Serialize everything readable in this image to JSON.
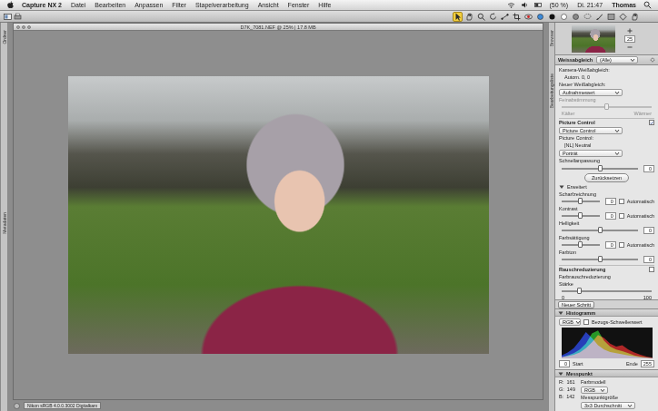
{
  "menubar": {
    "app": "Capture NX 2",
    "items": [
      "Datei",
      "Bearbeiten",
      "Anpassen",
      "Filter",
      "Stapelverarbeitung",
      "Ansicht",
      "Fenster",
      "Hilfe"
    ],
    "battery": "(50 %)",
    "clock": "Di. 21:47",
    "user": "Thomas"
  },
  "toolbar": {
    "tools": [
      {
        "kind": "arrow",
        "selected": true
      },
      {
        "kind": "hand",
        "selected": false
      },
      {
        "kind": "zoom",
        "selected": false
      },
      {
        "kind": "rotate",
        "selected": false
      },
      {
        "kind": "straighten",
        "selected": false
      },
      {
        "kind": "crop",
        "selected": false
      },
      {
        "kind": "redeye",
        "selected": false
      },
      {
        "kind": "point-color",
        "selected": false
      },
      {
        "kind": "point-black",
        "selected": false
      },
      {
        "kind": "point-white",
        "selected": false
      },
      {
        "kind": "point-neutral",
        "selected": false
      },
      {
        "kind": "lasso",
        "selected": false
      },
      {
        "kind": "brush",
        "selected": false
      },
      {
        "kind": "gradient",
        "selected": false
      },
      {
        "kind": "erase",
        "selected": false
      },
      {
        "kind": "hand",
        "selected": false
      }
    ]
  },
  "left_tabs": [
    "Ordner",
    "Metadaten"
  ],
  "right_tabs": [
    "Browser",
    "Bearbeitungsliste"
  ],
  "image_window": {
    "title": "D7K_7081.NEF @ 25% | 17.8 MB"
  },
  "status_bar": {
    "text": "Nikon sRGB 4.0.0.3002 Digitalkam"
  },
  "navigator": {
    "zoom": "25"
  },
  "adjustments": {
    "title": "Weissabgleich",
    "filter": "(Alle)",
    "new_step": "Neuer Schritt",
    "rows": [
      {
        "kind": "label",
        "text": "Kamera-Weißabgleich:"
      },
      {
        "kind": "value",
        "text": "Autom. 0, 0"
      },
      {
        "kind": "label",
        "text": "Neuer Weißabgleich:"
      },
      {
        "kind": "select",
        "text": "Aufnahmewert",
        "disabled": false
      },
      {
        "kind": "range",
        "text": "Feinabstimmung",
        "low": "Kälter",
        "high": "Wärmer",
        "level": 0.5,
        "disabled": true
      },
      {
        "kind": "section",
        "text": "Picture Control",
        "checked": true
      },
      {
        "kind": "select",
        "text": "Picture Control",
        "disabled": false
      },
      {
        "kind": "label",
        "text": "Picture Control:"
      },
      {
        "kind": "value",
        "text": "[NL] Neutral"
      },
      {
        "kind": "select",
        "text": "Porträt",
        "disabled": false
      },
      {
        "kind": "label",
        "text": "Schnellanpassung"
      },
      {
        "kind": "quick",
        "value": "0",
        "level": 0.5
      },
      {
        "kind": "button",
        "text": "Zurücksetzen"
      },
      {
        "kind": "disclosure",
        "text": "Erweitert",
        "expanded": true
      },
      {
        "kind": "adjust",
        "text": "Scharfzeichnung",
        "value": "0",
        "level": 0.5,
        "auto": "Automatisch",
        "auto_checked": false
      },
      {
        "kind": "adjust",
        "text": "Kontrast",
        "value": "0",
        "level": 0.5,
        "auto": "Automatisch",
        "auto_checked": false
      },
      {
        "kind": "adjust",
        "text": "Helligkeit",
        "value": "0",
        "level": 0.5
      },
      {
        "kind": "adjust",
        "text": "Farbsättigung",
        "value": "0",
        "level": 0.5,
        "auto": "Automatisch",
        "auto_checked": false
      },
      {
        "kind": "adjust",
        "text": "Farbton",
        "value": "0",
        "level": 0.5
      },
      {
        "kind": "section",
        "text": "Rauschreduzierung",
        "checked": false
      },
      {
        "kind": "label",
        "text": "Farbrauschreduzierung"
      },
      {
        "kind": "range",
        "text": "Stärke",
        "low": "0",
        "high": "100",
        "level": 0.2,
        "disabled": false
      }
    ]
  },
  "histogram": {
    "title": "Histogramm",
    "channel": "RGB",
    "threshold_label": "Bezugs-Schwellenwert",
    "threshold_checked": false,
    "series": [
      {
        "name": "R",
        "color": "#e02020",
        "values": [
          5,
          8,
          12,
          20,
          35,
          55,
          80,
          70,
          50,
          40,
          45,
          30,
          20,
          12,
          6,
          2
        ]
      },
      {
        "name": "G",
        "color": "#20c020",
        "values": [
          4,
          10,
          18,
          30,
          50,
          85,
          95,
          60,
          40,
          30,
          25,
          18,
          10,
          6,
          3,
          1
        ]
      },
      {
        "name": "B",
        "color": "#2040f0",
        "values": [
          10,
          20,
          35,
          60,
          90,
          70,
          45,
          30,
          22,
          18,
          14,
          10,
          7,
          4,
          2,
          1
        ]
      }
    ],
    "start_label": "Start",
    "start": "0",
    "end_label": "Ende",
    "end": "255"
  },
  "measure": {
    "title": "Messpunkt",
    "color_model_label": "Farbmodell",
    "color_model": "RGB",
    "size_label": "Messpunktgröße",
    "size": "3x3 Durchschnitt",
    "readings": [
      {
        "channel": "R:",
        "value": "161"
      },
      {
        "channel": "G:",
        "value": "149"
      },
      {
        "channel": "B:",
        "value": "142"
      }
    ]
  }
}
